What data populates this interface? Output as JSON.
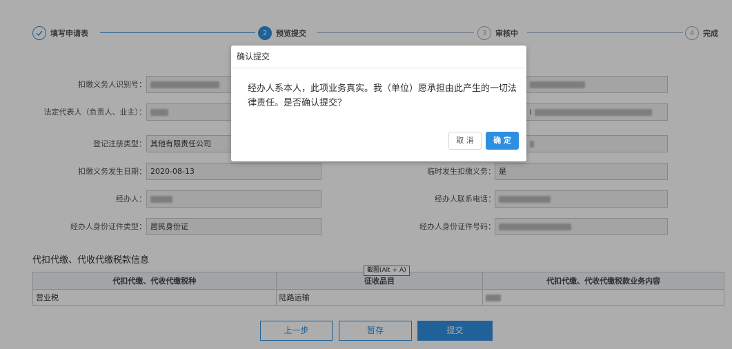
{
  "steps": [
    {
      "num": "",
      "label": "填写申请表",
      "state": "done"
    },
    {
      "num": "2",
      "label": "预览提交",
      "state": "active"
    },
    {
      "num": "3",
      "label": "审核中",
      "state": "pending"
    },
    {
      "num": "4",
      "label": "完成",
      "state": "pending"
    }
  ],
  "form": {
    "withholder_id_label": "扣缴义务人识别号：",
    "legal_rep_label": "法定代表人（负责人、业主）：",
    "reg_type_label": "登记注册类型：",
    "reg_type_value": "其他有限责任公司",
    "occur_date_label": "扣缴义务发生日期：",
    "occur_date_value": "2020-08-13",
    "temp_label": "临时发生扣缴义务：",
    "temp_value": "是",
    "handler_label": "经办人：",
    "handler_phone_label": "经办人联系电话：",
    "handler_id_type_label": "经办人身份证件类型：",
    "handler_id_type_value": "居民身份证",
    "handler_id_no_label": "经办人身份证件号码：",
    "right_partial_value": "i"
  },
  "section_title": "代扣代缴、代收代缴税款信息",
  "table": {
    "headers": [
      "代扣代缴、代收代缴税种",
      "征收品目",
      "代扣代缴、代收代缴税款业务内容"
    ],
    "rows": [
      [
        "营业税",
        "陆路运输",
        ""
      ]
    ]
  },
  "tooltip": "截图(Alt + A)",
  "buttons": {
    "prev": "上一步",
    "save": "暂存",
    "submit": "提交"
  },
  "dialog": {
    "title": "确认提交",
    "body": "经办人系本人，此项业务真实。我（单位）愿承担由此产生的一切法律责任。是否确认提交？",
    "cancel": "取 消",
    "ok": "确 定"
  },
  "colors": {
    "accent": "#2e8fe0",
    "overlay": "rgba(0,0,0,0.32)"
  }
}
